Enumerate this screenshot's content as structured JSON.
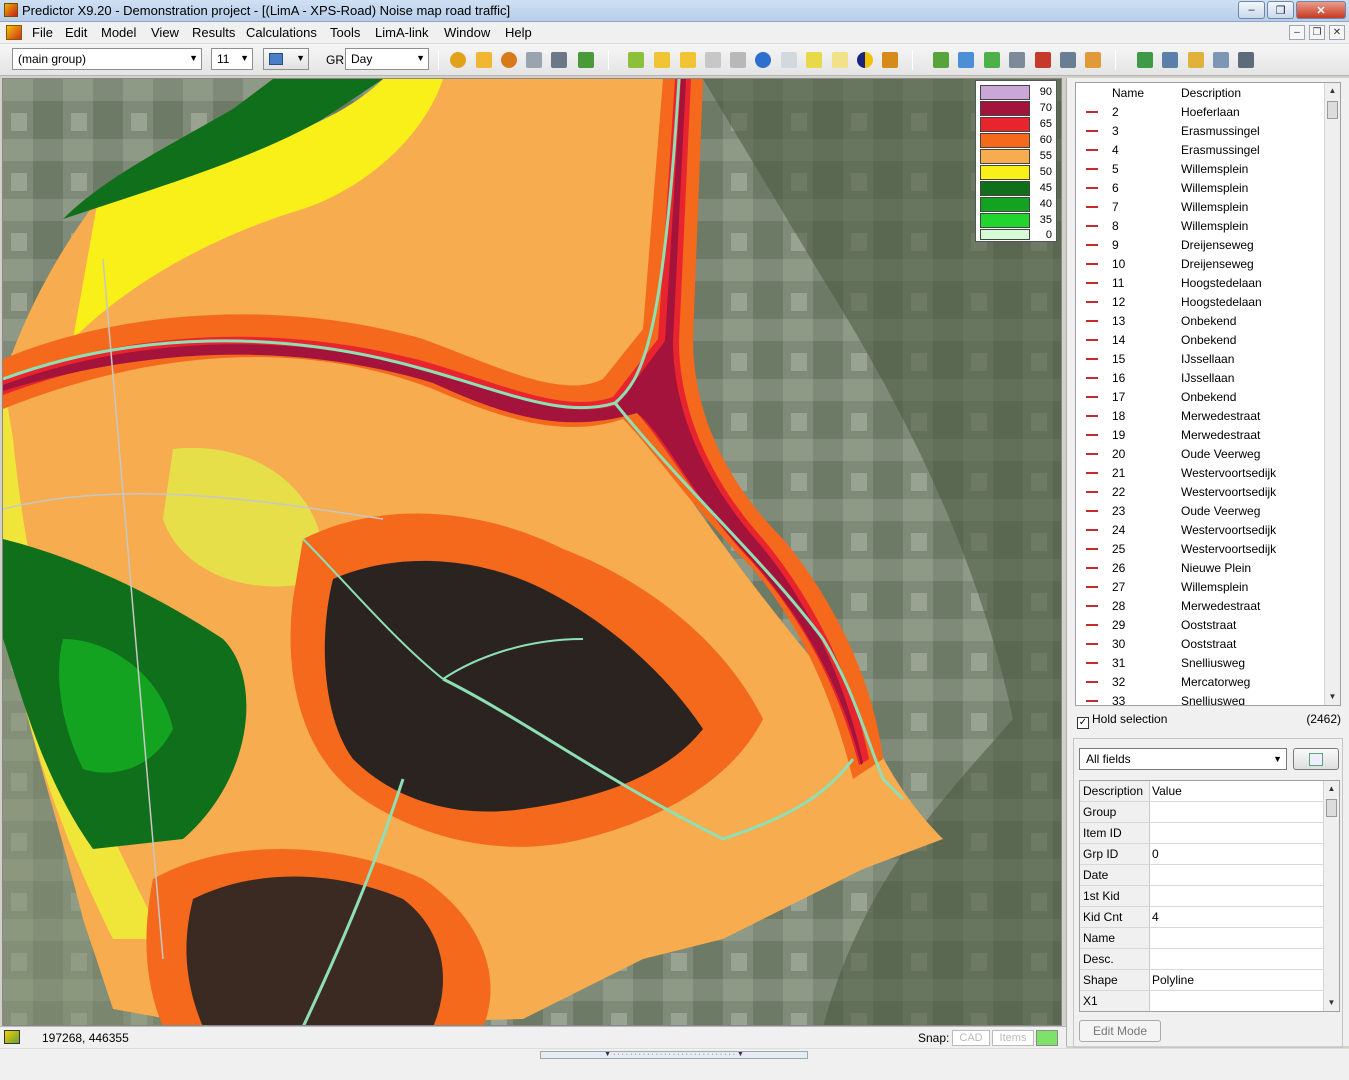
{
  "window": {
    "title": "Predictor X9.20 - Demonstration project - [(LimA - XPS-Road) Noise map road traffic]",
    "controls": [
      "–",
      "❐",
      "✕"
    ]
  },
  "menu": {
    "items": [
      "File",
      "Edit",
      "Model",
      "View",
      "Results",
      "Calculations",
      "Tools",
      "LimA-link",
      "Window",
      "Help"
    ],
    "mdi_controls": [
      "–",
      "❐",
      "✕"
    ]
  },
  "toolbar": {
    "group_combo": "(main group)",
    "size_combo": "11",
    "gr_label": "GR",
    "period_combo": "Day"
  },
  "legend": {
    "levels": [
      {
        "value": "90",
        "color": "#c9a7d6"
      },
      {
        "value": "70",
        "color": "#a3133c"
      },
      {
        "value": "65",
        "color": "#e8242f"
      },
      {
        "value": "60",
        "color": "#f4691c"
      },
      {
        "value": "55",
        "color": "#f6ac4f"
      },
      {
        "value": "50",
        "color": "#f8f018"
      },
      {
        "value": "45",
        "color": "#0f6f1b"
      },
      {
        "value": "40",
        "color": "#13a320"
      },
      {
        "value": "35",
        "color": "#21d42e"
      },
      {
        "value": "0",
        "color": "#d6fad5"
      }
    ]
  },
  "object_list": {
    "headers": {
      "name": "Name",
      "description": "Description"
    },
    "rows": [
      {
        "name": "2",
        "desc": "Hoeferlaan"
      },
      {
        "name": "3",
        "desc": "Erasmussingel"
      },
      {
        "name": "4",
        "desc": "Erasmussingel"
      },
      {
        "name": "5",
        "desc": "Willemsplein"
      },
      {
        "name": "6",
        "desc": "Willemsplein"
      },
      {
        "name": "7",
        "desc": "Willemsplein"
      },
      {
        "name": "8",
        "desc": "Willemsplein"
      },
      {
        "name": "9",
        "desc": "Dreijenseweg"
      },
      {
        "name": "10",
        "desc": "Dreijenseweg"
      },
      {
        "name": "11",
        "desc": "Hoogstedelaan"
      },
      {
        "name": "12",
        "desc": "Hoogstedelaan"
      },
      {
        "name": "13",
        "desc": "Onbekend"
      },
      {
        "name": "14",
        "desc": "Onbekend"
      },
      {
        "name": "15",
        "desc": "IJssellaan"
      },
      {
        "name": "16",
        "desc": "IJssellaan"
      },
      {
        "name": "17",
        "desc": "Onbekend"
      },
      {
        "name": "18",
        "desc": "Merwedestraat"
      },
      {
        "name": "19",
        "desc": "Merwedestraat"
      },
      {
        "name": "20",
        "desc": "Oude Veerweg"
      },
      {
        "name": "21",
        "desc": "Westervoortsedijk"
      },
      {
        "name": "22",
        "desc": "Westervoortsedijk"
      },
      {
        "name": "23",
        "desc": "Oude Veerweg"
      },
      {
        "name": "24",
        "desc": "Westervoortsedijk"
      },
      {
        "name": "25",
        "desc": "Westervoortsedijk"
      },
      {
        "name": "26",
        "desc": "Nieuwe Plein"
      },
      {
        "name": "27",
        "desc": "Willemsplein"
      },
      {
        "name": "28",
        "desc": "Merwedestraat"
      },
      {
        "name": "29",
        "desc": "Ooststraat"
      },
      {
        "name": "30",
        "desc": "Ooststraat"
      },
      {
        "name": "31",
        "desc": "Snelliusweg"
      },
      {
        "name": "32",
        "desc": "Mercatorweg"
      },
      {
        "name": "33",
        "desc": "Snelliusweg"
      }
    ],
    "hold_selection": "Hold selection",
    "hold_checked": "✓",
    "count": "(2462)"
  },
  "properties": {
    "fields_combo": "All fields",
    "headers": {
      "key": "Description",
      "value": "Value"
    },
    "rows": [
      {
        "key": "Group",
        "value": ""
      },
      {
        "key": "Item ID",
        "value": ""
      },
      {
        "key": "Grp ID",
        "value": "0"
      },
      {
        "key": "Date",
        "value": ""
      },
      {
        "key": "1st Kid",
        "value": ""
      },
      {
        "key": "Kid Cnt",
        "value": "4"
      },
      {
        "key": "Name",
        "value": ""
      },
      {
        "key": "Desc.",
        "value": ""
      },
      {
        "key": "Shape",
        "value": "Polyline"
      },
      {
        "key": "X1",
        "value": ""
      }
    ],
    "edit_mode_label": "Edit Mode"
  },
  "status": {
    "coords": "197268, 446355",
    "snap_label": "Snap:",
    "snap_cad": "CAD",
    "snap_items": "Items"
  }
}
